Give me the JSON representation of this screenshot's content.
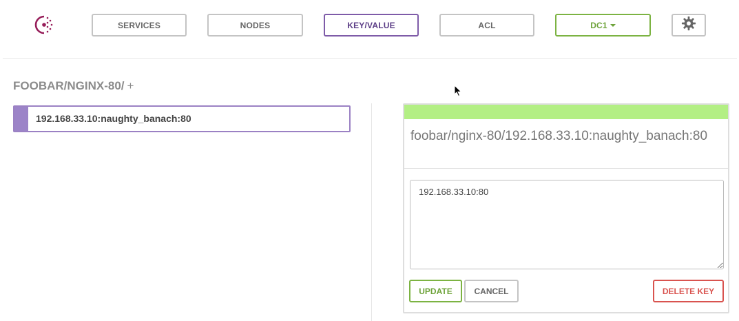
{
  "nav": {
    "services_label": "SERVICES",
    "nodes_label": "NODES",
    "kv_label": "KEY/VALUE",
    "acl_label": "ACL",
    "dc_label": "DC1",
    "logo_icon": "consul-logo-icon",
    "settings_icon": "gear-icon"
  },
  "breadcrumb": {
    "path": "FOOBAR/NGINX-80/",
    "add_label": "+"
  },
  "keys": [
    {
      "label": "192.168.33.10:naughty_banach:80"
    }
  ],
  "editor": {
    "title": "foobar/nginx-80/192.168.33.10:naughty_banach:80",
    "value": "192.168.33.10:80",
    "update_label": "UPDATE",
    "cancel_label": "CANCEL",
    "delete_label": "DELETE KEY"
  },
  "colors": {
    "accent": "#7e5ba8",
    "success": "#7cb342",
    "status_bar": "#b3ef84",
    "danger": "#d9534f",
    "brand": "#961d59"
  }
}
